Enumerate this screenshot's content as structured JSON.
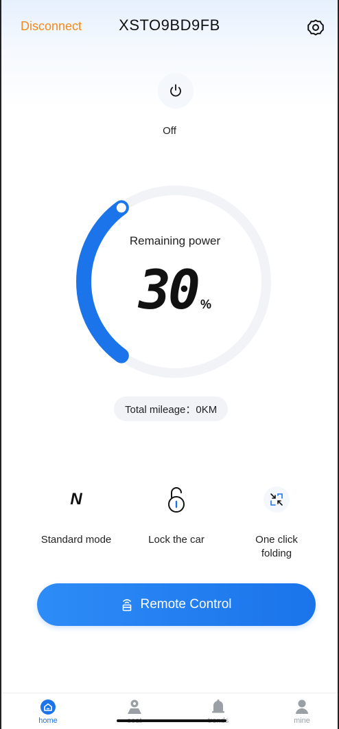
{
  "header": {
    "disconnect_label": "Disconnect",
    "device_name": "XSTO9BD9FB",
    "settings_icon": "gear-icon"
  },
  "power": {
    "icon": "power-icon",
    "status": "Off"
  },
  "battery": {
    "label": "Remaining power",
    "value": "30",
    "unit": "%",
    "level": 0.3,
    "track_color": "#f1f3f6",
    "fill_color": "#1b74ea"
  },
  "mileage": {
    "text": "Total mileage：0KM"
  },
  "actions": [
    {
      "icon": "mode-n-icon",
      "glyph": "N",
      "label": "Standard mode"
    },
    {
      "icon": "lock-icon",
      "label": "Lock the car"
    },
    {
      "icon": "fold-icon",
      "label": "One click folding"
    }
  ],
  "remote": {
    "icon": "remote-icon",
    "label": "Remote Control"
  },
  "tabs": [
    {
      "icon": "home-icon",
      "label": "home",
      "active": true
    },
    {
      "icon": "seat-icon",
      "label": "seat",
      "active": false
    },
    {
      "icon": "bell-icon",
      "label": "trends",
      "active": false
    },
    {
      "icon": "user-icon",
      "label": "mine",
      "active": false
    }
  ],
  "colors": {
    "accent": "#1b74ea",
    "disconnect": "#f08a1c"
  }
}
